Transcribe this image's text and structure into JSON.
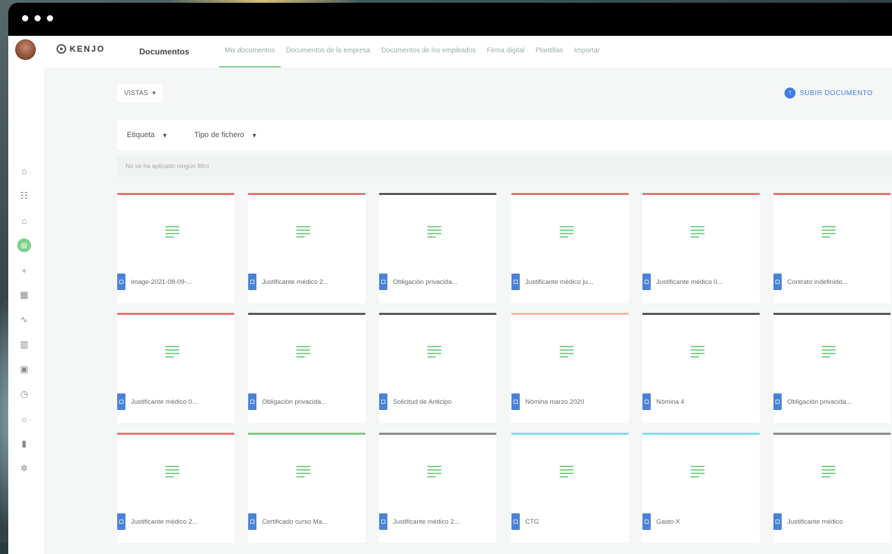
{
  "window": {
    "dots": 3
  },
  "user": {
    "avatar": "avatar-photo"
  },
  "brand": {
    "logo_text": "KENJO"
  },
  "header": {
    "section_title": "Documentos",
    "tabs": [
      {
        "label": "Mis documentos",
        "active": true
      },
      {
        "label": "Documentos de la empresa",
        "active": false
      },
      {
        "label": "Documentos de los empleados",
        "active": false
      },
      {
        "label": "Firma digital",
        "active": false
      },
      {
        "label": "Plantillas",
        "active": false
      },
      {
        "label": "Importar",
        "active": false
      }
    ]
  },
  "sidebar": {
    "icons": [
      "home-icon",
      "people-icon",
      "building-icon",
      "documents-icon",
      "plus-icon",
      "calendar-icon",
      "activity-icon",
      "chart-icon",
      "clipboard-icon",
      "clock-icon",
      "recruiting-icon",
      "grid-icon",
      "settings-icon"
    ],
    "active": "documents-icon"
  },
  "toolbar": {
    "views_label": "VISTAS",
    "upload_label": "SUBIR DOCUMENTO"
  },
  "filters": {
    "tags_label": "Etiqueta",
    "filetype_label": "Tipo de fichero",
    "empty_text": "No se ha aplicado ningún filtro"
  },
  "colors": {
    "accent_green": "#7ed08a",
    "accent_blue": "#4a82d8",
    "line_red": "#e57373",
    "line_dark": "#555555",
    "line_green": "#81c784",
    "line_cyan": "#80deea",
    "line_peach": "#f0b9a0",
    "line_gray": "#888888"
  },
  "documents": [
    {
      "name": "image-2021-08-09-...",
      "line": "line_red"
    },
    {
      "name": "Justificante médico 2...",
      "line": "line_red"
    },
    {
      "name": "Obligación privacida...",
      "line": "line_dark"
    },
    {
      "name": "Justificante médico ju...",
      "line": "line_red"
    },
    {
      "name": "Justificante médico 0...",
      "line": "line_red"
    },
    {
      "name": "Contrato indefinido...",
      "line": "line_red"
    },
    {
      "name": "Justificante médico 0...",
      "line": "line_red"
    },
    {
      "name": "Obligación privacida...",
      "line": "line_dark"
    },
    {
      "name": "Solicitud de Anticipo",
      "line": "line_dark"
    },
    {
      "name": "Nómina marzo 2020",
      "line": "line_peach"
    },
    {
      "name": "Nómina 4",
      "line": "line_dark"
    },
    {
      "name": "Obligación privacida...",
      "line": "line_dark"
    },
    {
      "name": "Justificante médico 2...",
      "line": "line_red"
    },
    {
      "name": "Certificado curso Ma...",
      "line": "line_green"
    },
    {
      "name": "Justificante médico 2...",
      "line": "line_gray"
    },
    {
      "name": "CTG",
      "line": "line_cyan"
    },
    {
      "name": "Gasto X",
      "line": "line_cyan"
    },
    {
      "name": "Justificante médico",
      "line": "line_gray"
    }
  ]
}
